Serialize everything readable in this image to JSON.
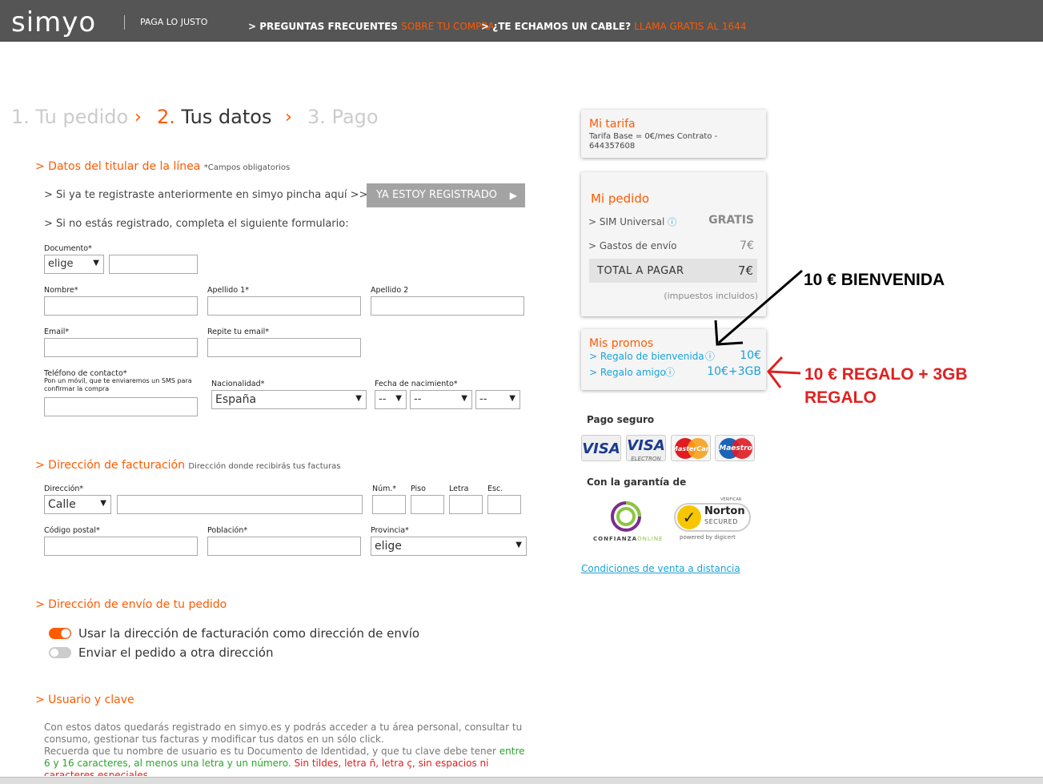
{
  "header": {
    "logo": "simyo",
    "tagline": "PAGA LO JUSTO",
    "nav1": {
      "prefix": "> PREGUNTAS FRECUENTES ",
      "highlight": "SOBRE TU COMPRA"
    },
    "nav2": {
      "prefix": "> ¿TE ECHAMOS UN CABLE? ",
      "highlight": "LLAMA GRATIS AL 1644"
    }
  },
  "steps": [
    {
      "num": "1.",
      "label": "Tu pedido"
    },
    {
      "num": "2.",
      "label": "Tus datos"
    },
    {
      "num": "3.",
      "label": "Pago"
    }
  ],
  "titular": {
    "title": "> Datos del titular de la línea",
    "note": "*Campos obligatorios",
    "registered_text": "> Si ya te registraste anteriormente en simyo pincha aquí >>>",
    "registered_button": "YA ESTOY REGISTRADO",
    "not_registered_text": "> Si no estás registrado, completa el siguiente formulario:",
    "documento_label": "Documento*",
    "documento_type": "elige",
    "nombre_label": "Nombre*",
    "apellido1_label": "Apellido 1*",
    "apellido2_label": "Apellido 2",
    "email_label": "Email*",
    "repite_email_label": "Repite tu email*",
    "telefono_label": "Teléfono de contacto*",
    "telefono_hint": "Pon un móvil, que te enviaremos un SMS para confirmar la compra",
    "nacionalidad_label": "Nacionalidad*",
    "nacionalidad_value": "España",
    "fecha_label": "Fecha de nacimiento*",
    "fecha_day": "--",
    "fecha_month": "--",
    "fecha_year": "--"
  },
  "facturacion": {
    "title": "> Dirección de facturación",
    "note": "Dirección donde recibirás tus facturas",
    "direccion_label": "Dirección*",
    "via_value": "Calle",
    "num_label": "Núm.*",
    "piso_label": "Piso",
    "letra_label": "Letra",
    "esc_label": "Esc.",
    "cp_label": "Código postal*",
    "poblacion_label": "Población*",
    "provincia_label": "Provincia*",
    "provincia_value": "elige"
  },
  "envio": {
    "title": "> Dirección de envío de tu pedido",
    "option1": "Usar la dirección de facturación como dirección de envío",
    "option2": "Enviar el pedido a otra dirección"
  },
  "usuario": {
    "title": "> Usuario y clave",
    "para1": "Con estos datos quedarás registrado en simyo.es y podrás acceder a tu área personal, consultar tu consumo, gestionar tus facturas y modificar tus datos en un sólo click.",
    "para2_a": "Recuerda que tu nombre de usuario es tu Documento de Identidad, y que tu clave debe tener ",
    "para2_green": "entre 6 y 16 caracteres, al menos una letra y un número.",
    "para2_red": " Sin tildes, letra ñ, letra ç, sin espacios ni caracteres especiales"
  },
  "sidebar": {
    "tarifa_title": "Mi tarifa",
    "tarifa_desc": "Tarifa Base = 0€/mes Contrato - 644357608",
    "pedido_title": "Mi pedido",
    "sim_label": "> SIM Universal",
    "sim_price": "GRATIS",
    "envio_label": "> Gastos de envío",
    "envio_price": "7€",
    "total_label": "TOTAL A PAGAR",
    "total_price": "7€",
    "impuestos": "(impuestos incluidos)",
    "promos_title": "Mis promos",
    "promo1_label": "> Regalo de bienvenida",
    "promo1_value": "10€",
    "promo2_label": "> Regalo amigo",
    "promo2_value": "10€+3GB",
    "pago_seguro": "Pago seguro",
    "cards": [
      "VISA",
      "VISA",
      "MasterCard",
      "Maestro"
    ],
    "electron": "ELECTRON",
    "garantia": "Con la garantía de",
    "confianza": "CONFIANZA",
    "confianza2": "ONLINE",
    "norton_verify": "VERIFICAR",
    "norton_name": "Norton",
    "norton_secured": "SECURED",
    "norton_powered": "powered by digicert",
    "condiciones": "Condiciones de venta a distancia"
  },
  "annotations": {
    "black": "10 € BIENVENIDA",
    "red1": "10 € REGALO + 3GB",
    "red2": "REGALO"
  },
  "colors": {
    "accent": "#ff5a00",
    "topbar": "#555555",
    "link": "#1aa3d9",
    "annotation_red": "#e02020"
  }
}
